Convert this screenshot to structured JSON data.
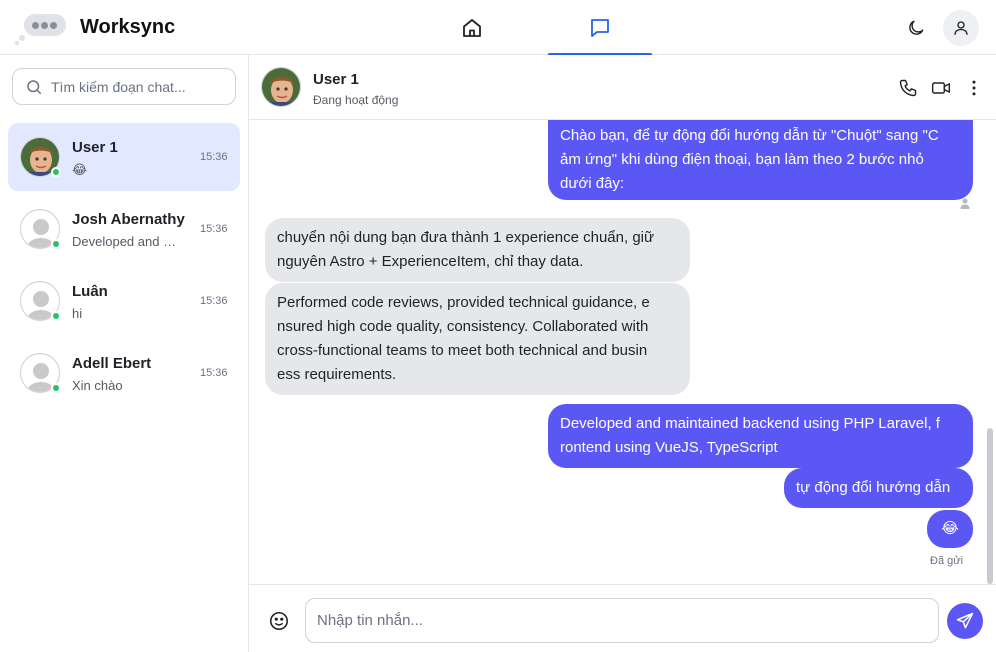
{
  "app": {
    "name": "Worksync"
  },
  "nav": {
    "home_icon": "home-icon",
    "chat_icon": "chat-icon",
    "theme_icon": "moon-icon",
    "account_icon": "user-icon"
  },
  "search": {
    "placeholder": "Tìm kiếm đoạn chat..."
  },
  "conversations": [
    {
      "name": "User 1",
      "preview": "😂",
      "time": "15:36",
      "online": true,
      "active": true,
      "avatar": "photo"
    },
    {
      "name": "Josh Abernathy",
      "preview": "Developed and maintained backend",
      "time": "15:36",
      "online": true,
      "active": false,
      "avatar": "default"
    },
    {
      "name": "Luân",
      "preview": "hi",
      "time": "15:36",
      "online": true,
      "active": false,
      "avatar": "default"
    },
    {
      "name": "Adell Ebert",
      "preview": "Xin chào",
      "time": "15:36",
      "online": true,
      "active": false,
      "avatar": "default"
    }
  ],
  "chat_header": {
    "name": "User 1",
    "status": "Đang hoạt động",
    "icons": [
      "phone-icon",
      "video-icon",
      "more-vertical-icon"
    ]
  },
  "messages": [
    {
      "direction": "out",
      "lines": [
        "Chào bạn, để tự động đổi hướng dẫn từ \"Chuột\" sang \"C",
        "ảm ứng\" khi dùng điện thoại, bạn làm theo 2 bước nhỏ",
        "dưới đây:"
      ]
    },
    {
      "direction": "in",
      "lines": [
        "chuyển nội dung bạn đưa thành 1 experience chuẩn, giữ",
        "nguyên Astro + ExperienceItem, chỉ thay data."
      ]
    },
    {
      "direction": "in",
      "lines": [
        "Performed code reviews, provided technical guidance, e",
        "nsured high code quality, consistency. Collaborated with",
        "cross-functional teams to meet both technical and busin",
        "ess requirements."
      ]
    },
    {
      "direction": "out",
      "lines": [
        "Developed and maintained backend using PHP Laravel, f",
        "rontend using VueJS, TypeScript"
      ]
    },
    {
      "direction": "out",
      "lines": [
        "tự động đổi hướng dẫn"
      ]
    },
    {
      "direction": "out",
      "lines": [
        "😂"
      ]
    }
  ],
  "sent_status": "Đã gửi",
  "composer": {
    "placeholder": "Nhập tin nhắn...",
    "emoji_icon": "smiley-icon",
    "send_icon": "send-icon"
  },
  "colors": {
    "accent": "#2563eb",
    "bubble_out": "#5b57f5",
    "bubble_in": "#e5e7eb",
    "active_conversation": "#e2e8ff",
    "online": "#22c55e"
  }
}
